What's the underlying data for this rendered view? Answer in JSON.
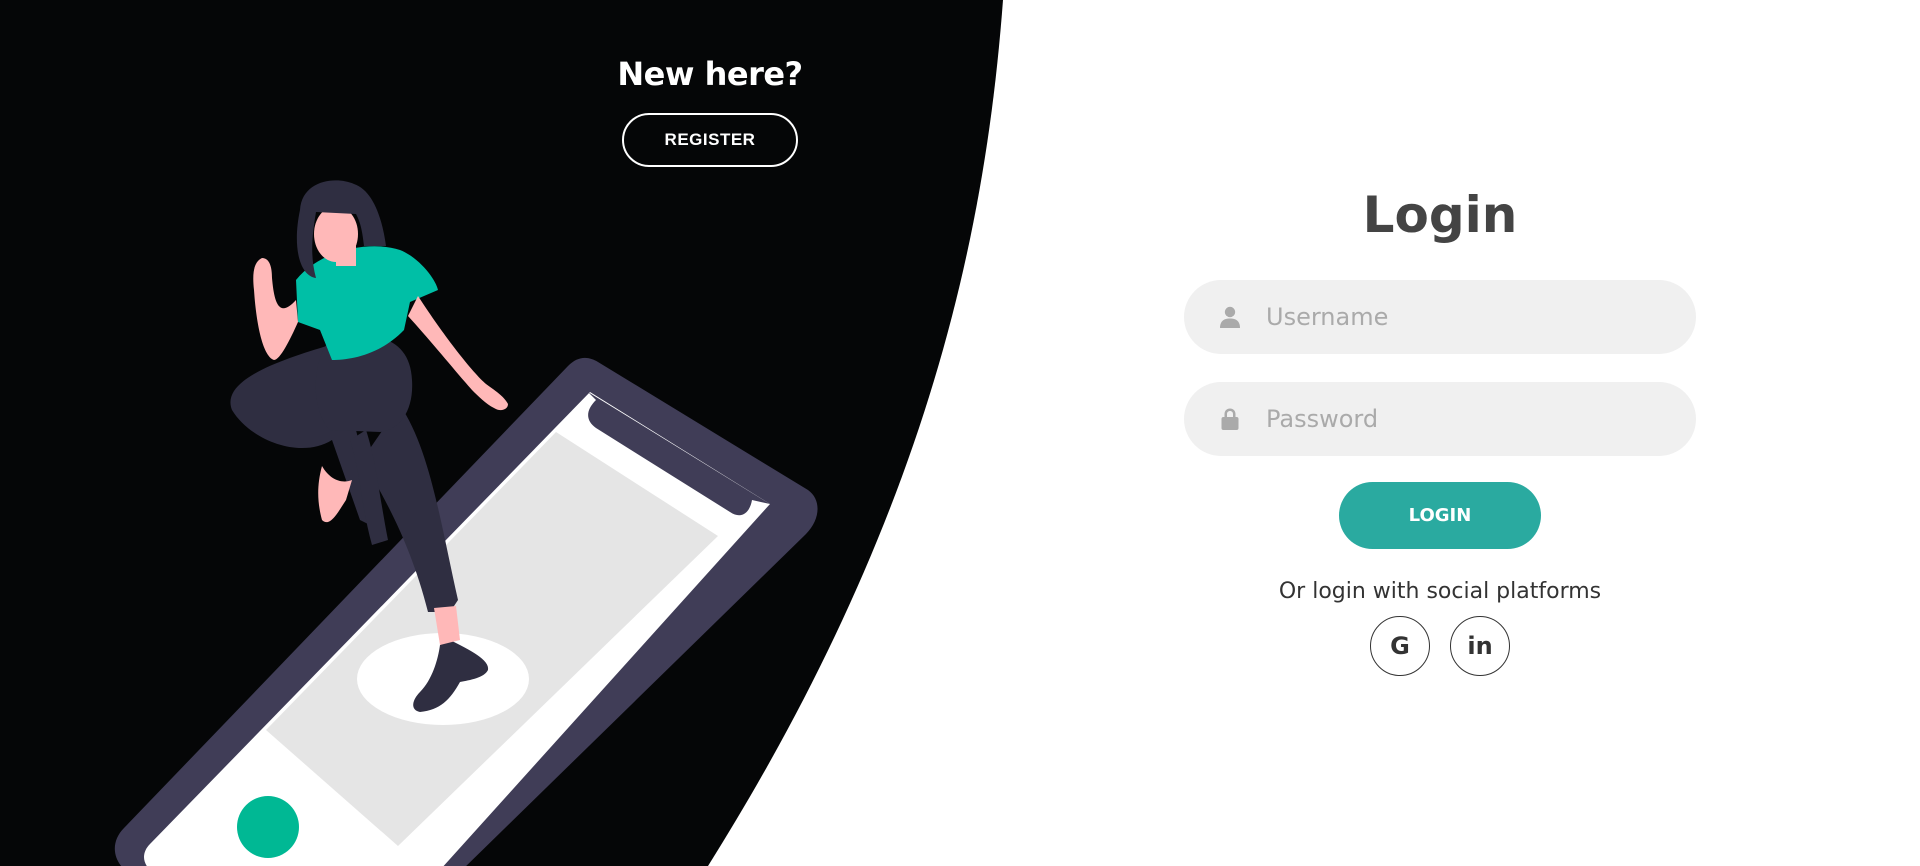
{
  "colors": {
    "panel_dark": "#050607",
    "accent": "#2aaaa0",
    "illustration_teal": "#00b894",
    "phone_frame": "#403d57",
    "title_text": "#444444",
    "input_bg": "#f0f0f0"
  },
  "left_panel": {
    "heading": "New here?",
    "register_label": "REGISTER"
  },
  "login_form": {
    "title": "Login",
    "username": {
      "placeholder": "Username",
      "value": "",
      "icon": "user-icon"
    },
    "password": {
      "placeholder": "Password",
      "value": "",
      "icon": "lock-icon"
    },
    "submit_label": "LOGIN",
    "social_text": "Or login with social platforms",
    "social_buttons": [
      {
        "label": "G",
        "icon": "google-icon"
      },
      {
        "label": "in",
        "icon": "linkedin-icon"
      }
    ]
  }
}
